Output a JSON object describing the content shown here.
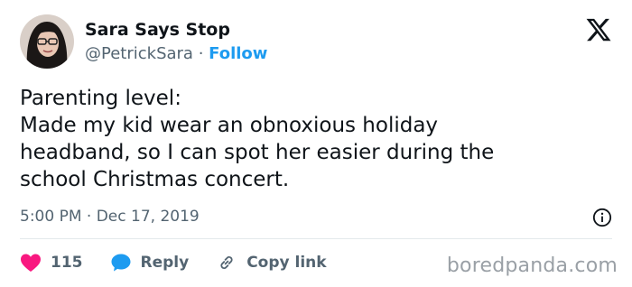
{
  "author": {
    "display_name": "Sara Says Stop",
    "handle": "@PetrickSara",
    "separator": "·",
    "follow_label": "Follow"
  },
  "tweet": {
    "lines": [
      "Parenting level:",
      "Made my kid wear an obnoxious holiday",
      "headband, so I can spot her easier during the",
      "school Christmas concert."
    ],
    "timestamp": "5:00 PM · Dec 17, 2019"
  },
  "actions": {
    "likes_count": "115",
    "reply_label": "Reply",
    "copy_link_label": "Copy link"
  },
  "watermark": "boredpanda.com",
  "colors": {
    "accent": "#1d9bf0",
    "like": "#f91880",
    "muted": "#536471",
    "text": "#0f1419"
  },
  "icons": {
    "logo": "x-logo-icon",
    "info": "info-icon",
    "like": "heart-icon",
    "reply": "speech-bubble-icon",
    "copy": "link-icon"
  }
}
